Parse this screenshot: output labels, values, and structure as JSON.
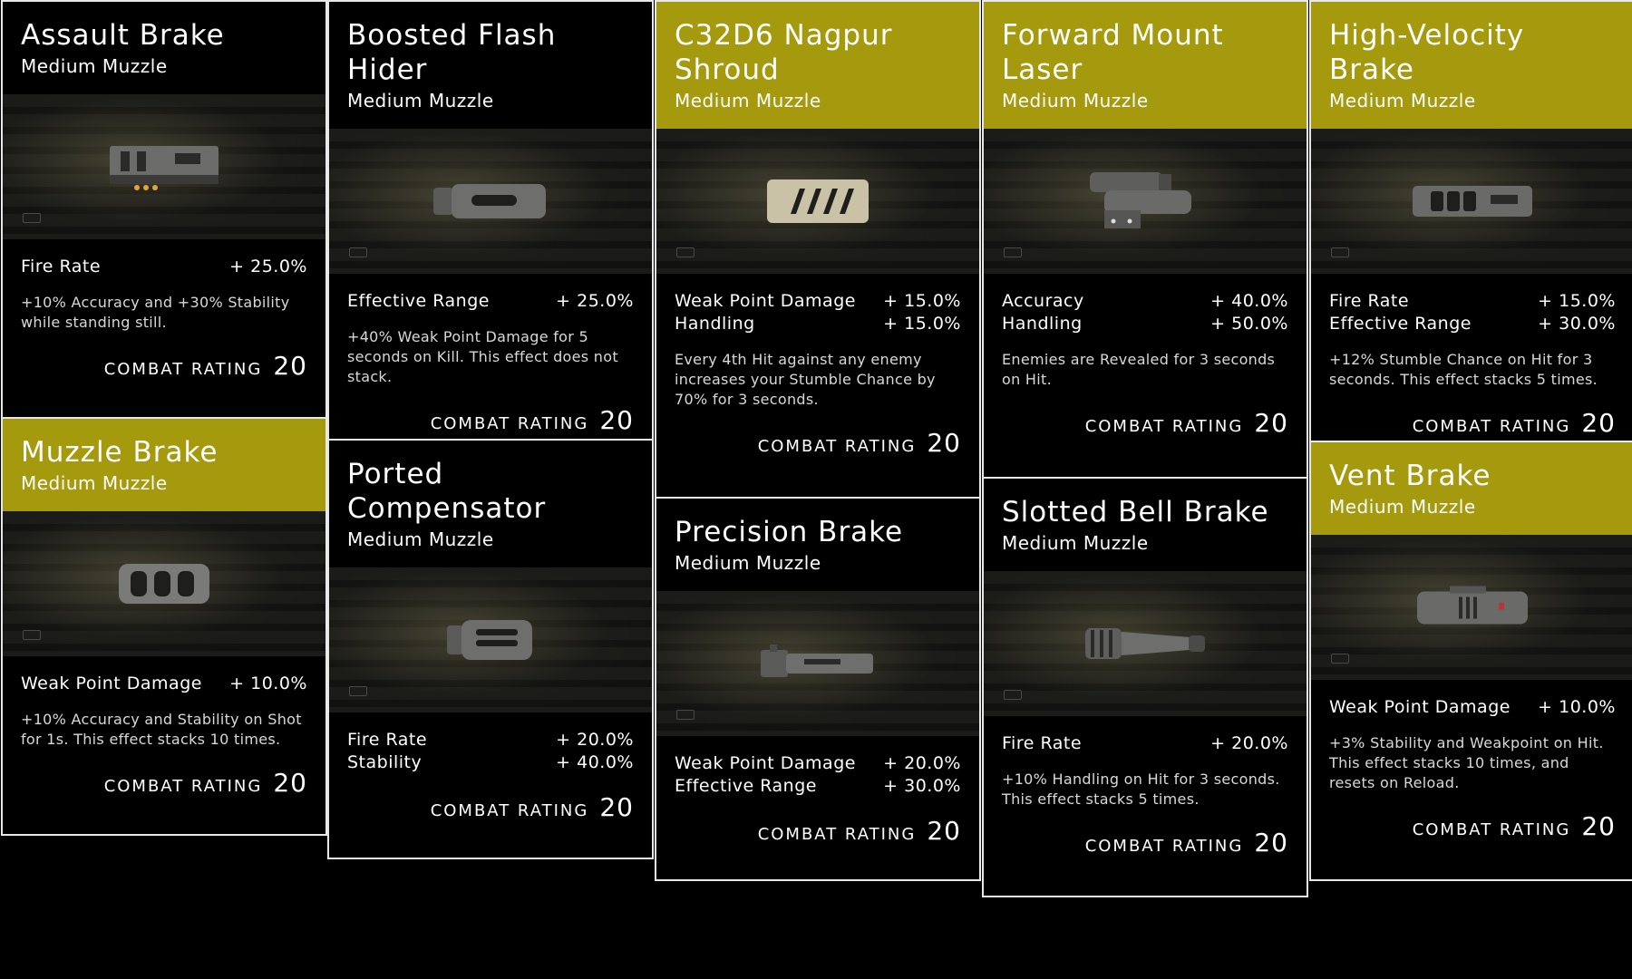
{
  "cards": [
    {
      "title": "Assault Brake",
      "subtitle": "Medium Muzzle",
      "stats": [
        {
          "label": "Fire Rate",
          "value": "+ 25.0%"
        }
      ],
      "description": "+10% Accuracy and +30% Stability while standing still.",
      "rating_label": "COMBAT RATING",
      "rating_value": "20",
      "icon": "assault-brake-icon"
    },
    {
      "title": "Muzzle Brake",
      "subtitle": "Medium Muzzle",
      "stats": [
        {
          "label": "Weak Point Damage",
          "value": "+ 10.0%"
        }
      ],
      "description": "+10% Accuracy and Stability on Shot for 1s. This effect stacks 10 times.",
      "rating_label": "COMBAT RATING",
      "rating_value": "20",
      "icon": "muzzle-brake-icon"
    },
    {
      "title": "Boosted Flash Hider",
      "subtitle": "Medium Muzzle",
      "stats": [
        {
          "label": "Effective Range",
          "value": "+ 25.0%"
        }
      ],
      "description": "+40% Weak Point Damage for 5 seconds on Kill. This effect does not stack.",
      "rating_label": "COMBAT RATING",
      "rating_value": "20",
      "icon": "flash-hider-icon"
    },
    {
      "title": "Ported Compensator",
      "subtitle": "Medium Muzzle",
      "stats": [
        {
          "label": "Fire Rate",
          "value": "+ 20.0%"
        },
        {
          "label": "Stability",
          "value": "+ 40.0%"
        }
      ],
      "description": "",
      "rating_label": "COMBAT RATING",
      "rating_value": "20",
      "icon": "compensator-icon"
    },
    {
      "title": "C32D6 Nagpur Shroud",
      "subtitle": "Medium Muzzle",
      "stats": [
        {
          "label": "Weak Point Damage",
          "value": "+ 15.0%"
        },
        {
          "label": "Handling",
          "value": "+ 15.0%"
        }
      ],
      "description": "Every 4th Hit against any enemy increases your Stumble Chance by 70% for 3 seconds.",
      "rating_label": "COMBAT RATING",
      "rating_value": "20",
      "icon": "shroud-icon"
    },
    {
      "title": "Precision Brake",
      "subtitle": "Medium Muzzle",
      "stats": [
        {
          "label": "Weak Point Damage",
          "value": "+ 20.0%"
        },
        {
          "label": "Effective Range",
          "value": "+ 30.0%"
        }
      ],
      "description": "",
      "rating_label": "COMBAT RATING",
      "rating_value": "20",
      "icon": "precision-brake-icon"
    },
    {
      "title": "Forward Mount Laser",
      "subtitle": "Medium Muzzle",
      "stats": [
        {
          "label": "Accuracy",
          "value": "+ 40.0%"
        },
        {
          "label": "Handling",
          "value": "+ 50.0%"
        }
      ],
      "description": "Enemies are Revealed for 3 seconds on Hit.",
      "rating_label": "COMBAT RATING",
      "rating_value": "20",
      "icon": "laser-icon"
    },
    {
      "title": "Slotted Bell Brake",
      "subtitle": "Medium Muzzle",
      "stats": [
        {
          "label": "Fire Rate",
          "value": "+ 20.0%"
        }
      ],
      "description": "+10% Handling on Hit for 3 seconds. This effect stacks 5 times.",
      "rating_label": "COMBAT RATING",
      "rating_value": "20",
      "icon": "bell-brake-icon"
    },
    {
      "title": "High-Velocity Brake",
      "subtitle": "Medium Muzzle",
      "stats": [
        {
          "label": "Fire Rate",
          "value": "+ 15.0%"
        },
        {
          "label": "Effective Range",
          "value": "+ 30.0%"
        }
      ],
      "description": "+12% Stumble Chance on Hit for 3 seconds. This effect stacks 5 times.",
      "rating_label": "COMBAT RATING",
      "rating_value": "20",
      "icon": "hv-brake-icon"
    },
    {
      "title": "Vent Brake",
      "subtitle": "Medium Muzzle",
      "stats": [
        {
          "label": "Weak Point Damage",
          "value": "+ 10.0%"
        }
      ],
      "description": "+3% Stability and Weakpoint on Hit. This effect stacks 10 times, and resets on Reload.",
      "rating_label": "COMBAT RATING",
      "rating_value": "20",
      "icon": "vent-brake-icon"
    }
  ],
  "colors": {
    "featured_header": "#a59a0d",
    "card_border": "#e8e8e8",
    "background": "#000000"
  }
}
